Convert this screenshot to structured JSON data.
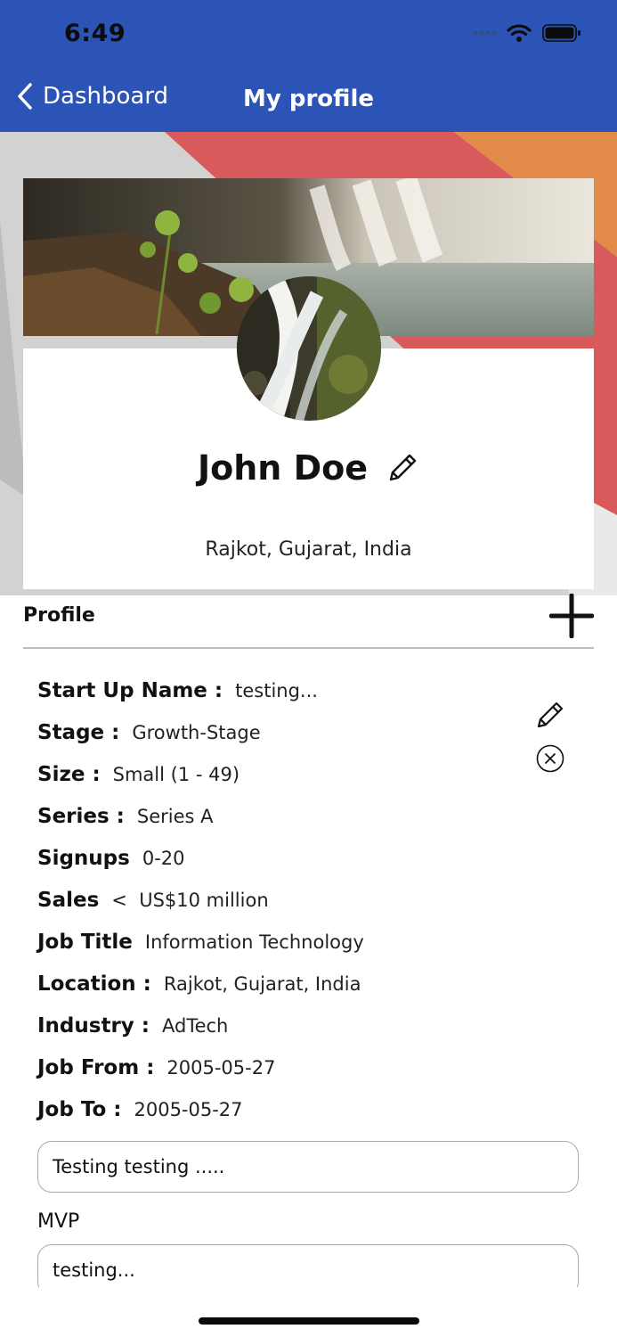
{
  "status_bar": {
    "time": "6:49"
  },
  "nav": {
    "back_label": "Dashboard",
    "title": "My profile"
  },
  "profile": {
    "name": "John Doe",
    "location": "Rajkot, Gujarat, India"
  },
  "section": {
    "title": "Profile"
  },
  "fields": [
    {
      "key": "Start Up Name :",
      "value": "testing..."
    },
    {
      "key": "Stage :",
      "value": "Growth-Stage"
    },
    {
      "key": "Size :",
      "value": "Small (1 - 49)"
    },
    {
      "key": "Series :",
      "value": "Series A"
    },
    {
      "key": "Signups",
      "value": "0-20"
    },
    {
      "key": "Sales",
      "value": "<  US$10 million"
    },
    {
      "key": "Job Title",
      "value": "Information Technology"
    },
    {
      "key": "Location :",
      "value": "Rajkot, Gujarat, India"
    },
    {
      "key": "Industry :",
      "value": "AdTech"
    },
    {
      "key": "Job From :",
      "value": "2005-05-27"
    },
    {
      "key": "Job To :",
      "value": "2005-05-27"
    }
  ],
  "description_box": "Testing testing .....",
  "mvp": {
    "label": "MVP",
    "value": "testing..."
  },
  "colors": {
    "nav_bg": "#2c54b6",
    "wedge_red": "#d85a5a",
    "wedge_orange": "#e28b48",
    "wedge_gray": "#c9c9c9"
  }
}
